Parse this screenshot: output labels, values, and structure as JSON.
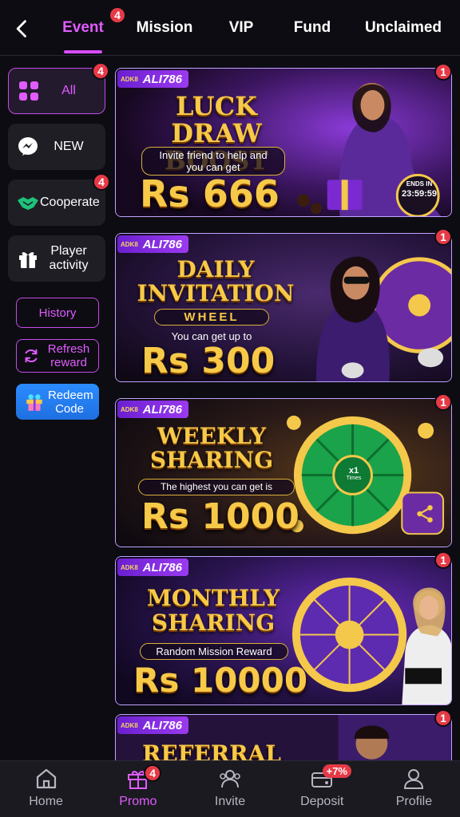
{
  "tabs": [
    {
      "label": "Event",
      "active": true,
      "badge": "4"
    },
    {
      "label": "Mission"
    },
    {
      "label": "VIP"
    },
    {
      "label": "Fund"
    },
    {
      "label": "Unclaimed"
    }
  ],
  "sidebar": {
    "categories": [
      {
        "label": "All",
        "icon": "grid-icon",
        "active": true,
        "badge": "4"
      },
      {
        "label": "NEW",
        "icon": "messenger-icon"
      },
      {
        "label": "Cooperate",
        "icon": "handshake-icon",
        "badge": "4"
      },
      {
        "label": "Player activity",
        "icon": "gift-icon"
      }
    ],
    "history_label": "History",
    "refresh_label": "Refresh reward",
    "redeem_label": "Redeem Code"
  },
  "banners": [
    {
      "brand": "ALI786",
      "brand_small": "ADK8",
      "title": "LUCK DRAW BOOST",
      "subtitle": "Invite friend to help and you can get",
      "amount": "Rs 666",
      "ends_label": "ENDS IN",
      "timer": "23:59:59",
      "badge": "1"
    },
    {
      "brand": "ALI786",
      "brand_small": "ADK8",
      "title": "DAILY INVITATION",
      "title2": "WHEEL",
      "subtitle": "You can get up to",
      "amount": "Rs 300",
      "badge": "1"
    },
    {
      "brand": "ALI786",
      "brand_small": "ADK8",
      "title": "WEEKLY SHARING",
      "subtitle": "The highest you can get is",
      "amount": "Rs 1000",
      "wheel_text": "x1",
      "wheel_sub": "Times",
      "badge": "1"
    },
    {
      "brand": "ALI786",
      "brand_small": "ADK8",
      "title": "MONTHLY SHARING",
      "subtitle": "Random Mission Reward",
      "amount": "Rs 10000",
      "badge": "1"
    },
    {
      "brand": "ALI786",
      "brand_small": "ADK8",
      "title": "REFERRAL",
      "badge": "1"
    }
  ],
  "bottom_nav": [
    {
      "label": "Home",
      "icon": "home-icon"
    },
    {
      "label": "Promo",
      "icon": "gift-icon",
      "active": true,
      "badge": "4"
    },
    {
      "label": "Invite",
      "icon": "invite-icon"
    },
    {
      "label": "Deposit",
      "icon": "deposit-icon",
      "tag": "+7%"
    },
    {
      "label": "Profile",
      "icon": "profile-icon"
    }
  ],
  "colors": {
    "accent": "#e05cff",
    "badge": "#e63946",
    "gold": "#f7c948",
    "background": "#0d0c12"
  }
}
